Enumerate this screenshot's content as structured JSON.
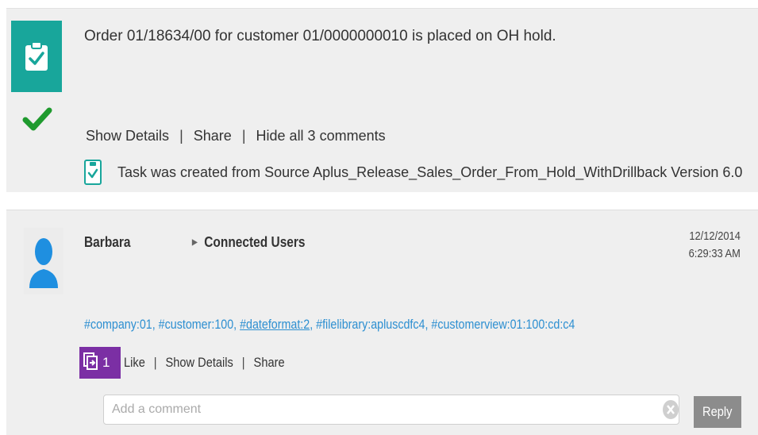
{
  "task_card": {
    "title": "Order 01/18634/00 for customer 01/0000000010 is placed on OH hold.",
    "actions": {
      "show_details": "Show Details",
      "share": "Share",
      "hide_comments": "Hide all 3 comments",
      "separator": "|"
    },
    "comment": {
      "text": "Task was created from Source Aplus_Release_Sales_Order_From_Hold_WithDrillback Version 6.0"
    },
    "icons": {
      "main": "clipboard-check-icon",
      "status": "checkmark-icon",
      "comment": "clipboard-check-icon"
    },
    "colors": {
      "teal": "#18a69b",
      "check_green": "#1f9a2e"
    }
  },
  "post_card": {
    "author": "Barbara",
    "group": "Connected Users",
    "date": "12/12/2014",
    "time": "6:29:33 AM",
    "hashtags": [
      {
        "text": "#company:01",
        "sep": ", "
      },
      {
        "text": "#customer:100",
        "sep": ", "
      },
      {
        "text": "#dateformat:2",
        "sep": ", "
      },
      {
        "text": "#filelibrary:apluscdfc4",
        "sep": ", "
      },
      {
        "text": "#customerview:01:100:cd:c4",
        "sep": ""
      }
    ],
    "like_count": "1",
    "actions": {
      "like": "Like",
      "show_details": "Show Details",
      "share": "Share",
      "separator": "|"
    },
    "comment_input": {
      "placeholder": "Add a comment",
      "value": ""
    },
    "reply_label": "Reply",
    "icons": {
      "avatar": "user-avatar-icon",
      "group_arrow": "triangle-right-icon",
      "like_badge": "share-box-icon",
      "clear": "clear-icon"
    },
    "colors": {
      "avatar_blue": "#1f8fe0",
      "hashtag_blue": "#2d8fd1",
      "like_purple": "#7b2fa4",
      "reply_gray": "#8c8c8c"
    }
  }
}
